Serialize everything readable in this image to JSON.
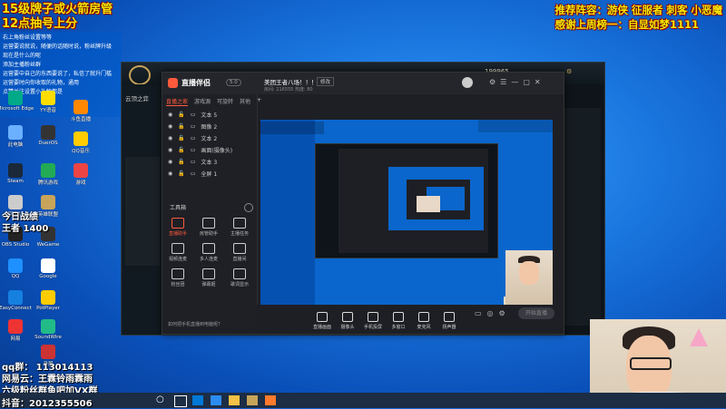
{
  "overlay": {
    "promo_line1": "15级牌子或火箭房管",
    "promo_line2": "12点抽号上分",
    "recommend": "推荐阵容：游侠 征服者 刺客 小恶魔",
    "thanks": "感谢上周榜一：自显如梦1111",
    "today_record": "今日战绩",
    "rank": "王者 1400",
    "qq_group": "qq群：  113014113",
    "net_cafe": "网易云：王霖铃雨霖雨",
    "fans_group": "六级粉丝群鱼吧加VX群",
    "douyin": "抖音：2012355506"
  },
  "top_left_panel": {
    "lines": [
      "右上角粉丝设置等等",
      "运营要说就说，随便的话随时说，粉丝牌升级",
      "现在是什么的呢",
      "添加主播粉丝群",
      "运营要中自己的东西要说了，私信了就升门槛",
      "运营要时向你收取的礼物，通用",
      "点赞关注设置小礼物都是"
    ]
  },
  "desktop_icons": [
    {
      "label": "此电脑",
      "color": "#6ab0ff"
    },
    {
      "label": "DuerOS",
      "color": "#333"
    },
    {
      "label": "Steam",
      "color": "#1b2838"
    },
    {
      "label": "腾讯游戏",
      "color": "#2a5"
    },
    {
      "label": "回收站",
      "color": "#ccc"
    },
    {
      "label": "英雄联盟",
      "color": "#c8a45a"
    },
    {
      "label": "OBS Studio",
      "color": "#222"
    },
    {
      "label": "WeGame",
      "color": "#333"
    },
    {
      "label": "QQ",
      "color": "#1e90ff"
    },
    {
      "label": "Google",
      "color": "#fff"
    },
    {
      "label": "EasyConnect",
      "color": "#1580e0"
    },
    {
      "label": "PotPlayer",
      "color": "#ffcc00"
    },
    {
      "label": "网易",
      "color": "#e33"
    },
    {
      "label": "SoundWire",
      "color": "#2b8"
    },
    {
      "label": "斗鱼直播",
      "color": "#f80"
    },
    {
      "label": "QQ音乐",
      "color": "#fc0"
    },
    {
      "label": "YY语音",
      "color": "#fd0"
    },
    {
      "label": "Microsoft Edge",
      "color": "#0a8"
    },
    {
      "label": "游戏",
      "color": "#e44"
    },
    {
      "label": "录屏",
      "color": "#c33"
    }
  ],
  "game": {
    "tab": "云顶之弈",
    "currency": "199965",
    "currency2": "216555"
  },
  "studio": {
    "app_name": "直播伴侣",
    "version": "5.0",
    "room_title": "美团王者八场！！！",
    "edit_label": "修改",
    "room_meta": "房间: 216555   热度: 80",
    "tabs": [
      "直播之家",
      "游戏源",
      "可旋转",
      "其他"
    ],
    "sources": [
      "文本 5",
      "图像 2",
      "文本 2",
      "画面(摄像头)",
      "文本 3",
      "全屏 1"
    ],
    "tools_label": "工具箱",
    "tools": [
      "直播助手",
      "房管助手",
      "主播任务",
      "视频连麦",
      "多人连麦",
      "直播间",
      "粉丝团",
      "弹幕姬",
      "歌词显示"
    ],
    "bottom": [
      "直播画面",
      "摄像头",
      "手机投屏",
      "多窗口",
      "麦克风",
      "扬声器"
    ],
    "start_label": "开始直播",
    "footer_tip": "如何把手机直播到电脑呢？"
  },
  "taskbar": {
    "search_placeholder": "在这里输入你要搜索的内容"
  }
}
